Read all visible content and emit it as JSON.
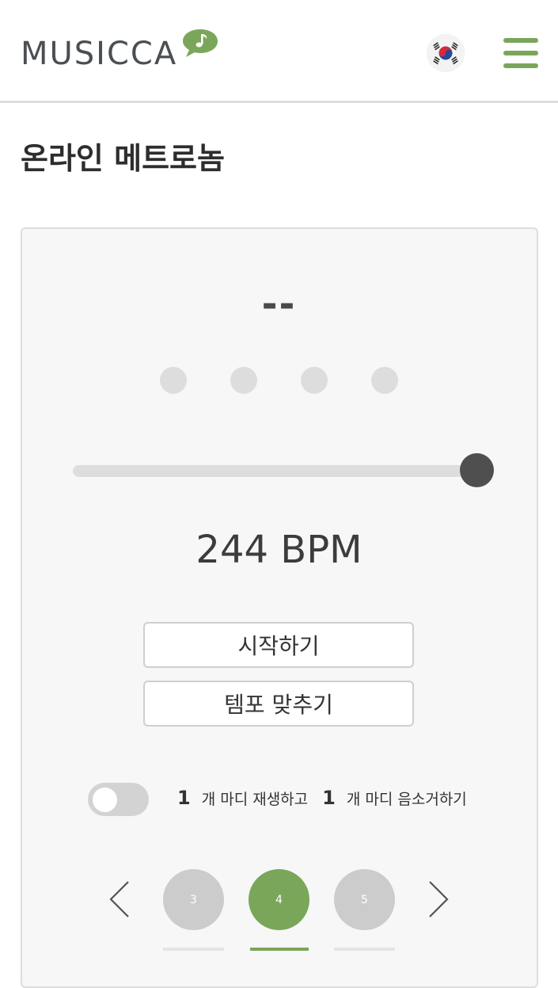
{
  "header": {
    "logo_text": "MUSICCA",
    "language_flag_icon": "south-korea-flag-icon",
    "menu_icon": "hamburger-menu-icon",
    "accent_color": "#7aa65a"
  },
  "page": {
    "title": "온라인 메트로놈"
  },
  "metronome": {
    "beat_display": "--",
    "beats": [
      false,
      false,
      false,
      false
    ],
    "tempo_slider_value_fraction": 1.0,
    "bpm_label": "244 BPM",
    "start_button": "시작하기",
    "tap_tempo_button": "템포 맞추기",
    "mute_toggle_on": false,
    "play_bars": "1",
    "play_bars_text": "개 마디 재생하고",
    "mute_bars": "1",
    "mute_bars_text": "개 마디 음소거하기"
  },
  "beats_per_bar_picker": {
    "options": [
      "3",
      "4",
      "5"
    ],
    "selected": "4"
  }
}
